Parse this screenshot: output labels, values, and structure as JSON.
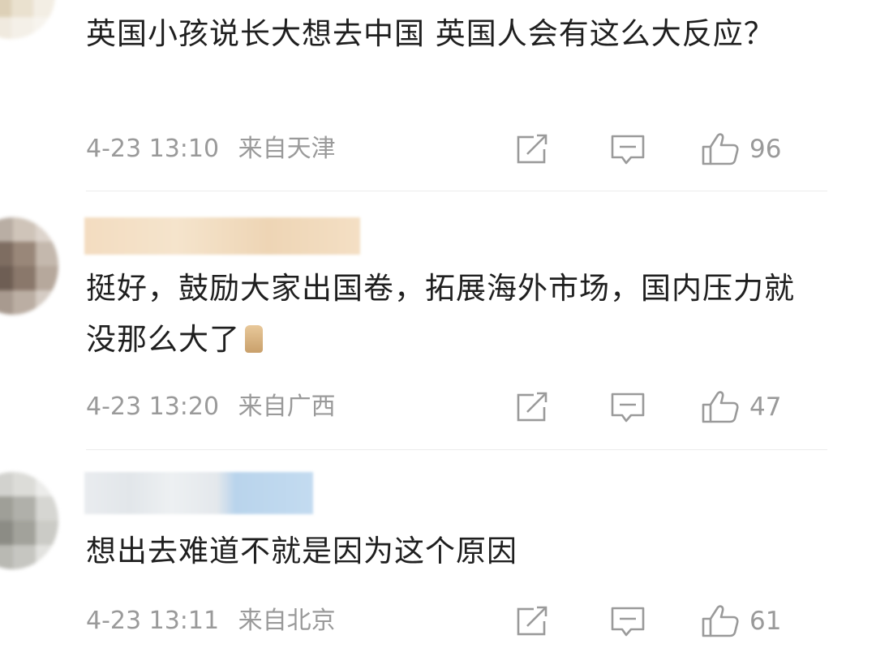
{
  "comments": [
    {
      "text": "英国小孩说长大想去中国 英国人会有这么大反应？",
      "date": "4-23 13:10",
      "location": "来自天津",
      "likes": "96"
    },
    {
      "text": "挺好，鼓励大家出国卷，拓展海外市场，国内压力就没那么大了",
      "date": "4-23 13:20",
      "location": "来自广西",
      "likes": "47"
    },
    {
      "text": "想出去难道不就是因为这个原因",
      "date": "4-23 13:11",
      "location": "来自北京",
      "likes": "61"
    }
  ],
  "icons": {
    "share": "share-icon",
    "reply": "comment-icon",
    "like": "thumbs-up-icon"
  },
  "colors": {
    "text": "#1f1f1f",
    "meta": "#9a9a9a",
    "divider": "#ececec"
  }
}
